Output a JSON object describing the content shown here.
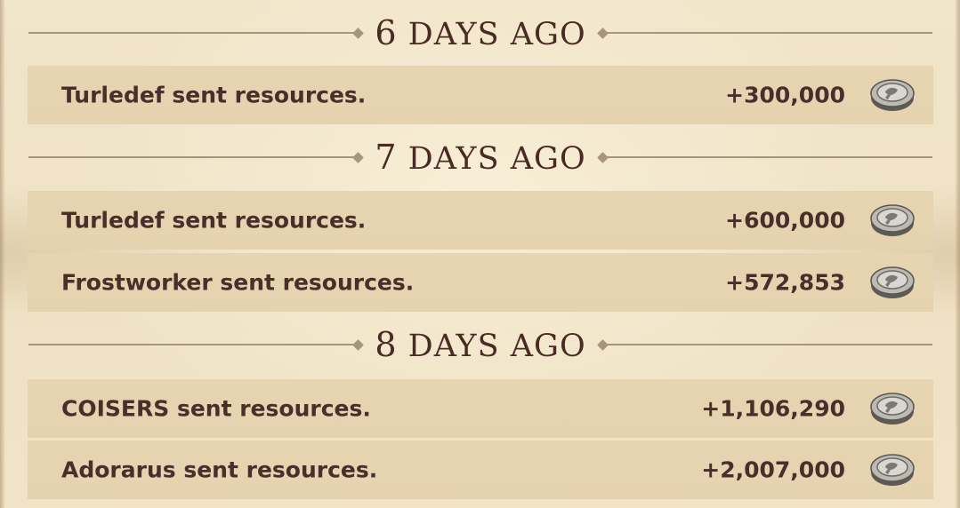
{
  "feed": {
    "sections": [
      {
        "header_number": "6",
        "header_text": "DAYS AGO",
        "rows": [
          {
            "text": "Turledef sent resources.",
            "amount": "+300,000",
            "icon": "silver-coin-icon"
          }
        ]
      },
      {
        "header_number": "7",
        "header_text": "DAYS AGO",
        "rows": [
          {
            "text": "Turledef sent resources.",
            "amount": "+600,000",
            "icon": "silver-coin-icon"
          },
          {
            "text": "Frostworker sent resources.",
            "amount": "+572,853",
            "icon": "silver-coin-icon"
          }
        ]
      },
      {
        "header_number": "8",
        "header_text": "DAYS AGO",
        "rows": [
          {
            "text": "COISERS sent resources.",
            "amount": "+1,106,290",
            "icon": "silver-coin-icon"
          },
          {
            "text": "Adorarus sent resources.",
            "amount": "+2,007,000",
            "icon": "silver-coin-icon"
          }
        ]
      }
    ]
  },
  "colors": {
    "background": "#f0e3c6",
    "row_background": "#e6d3b0",
    "text": "#4a2e2c",
    "divider": "#a8967c"
  }
}
